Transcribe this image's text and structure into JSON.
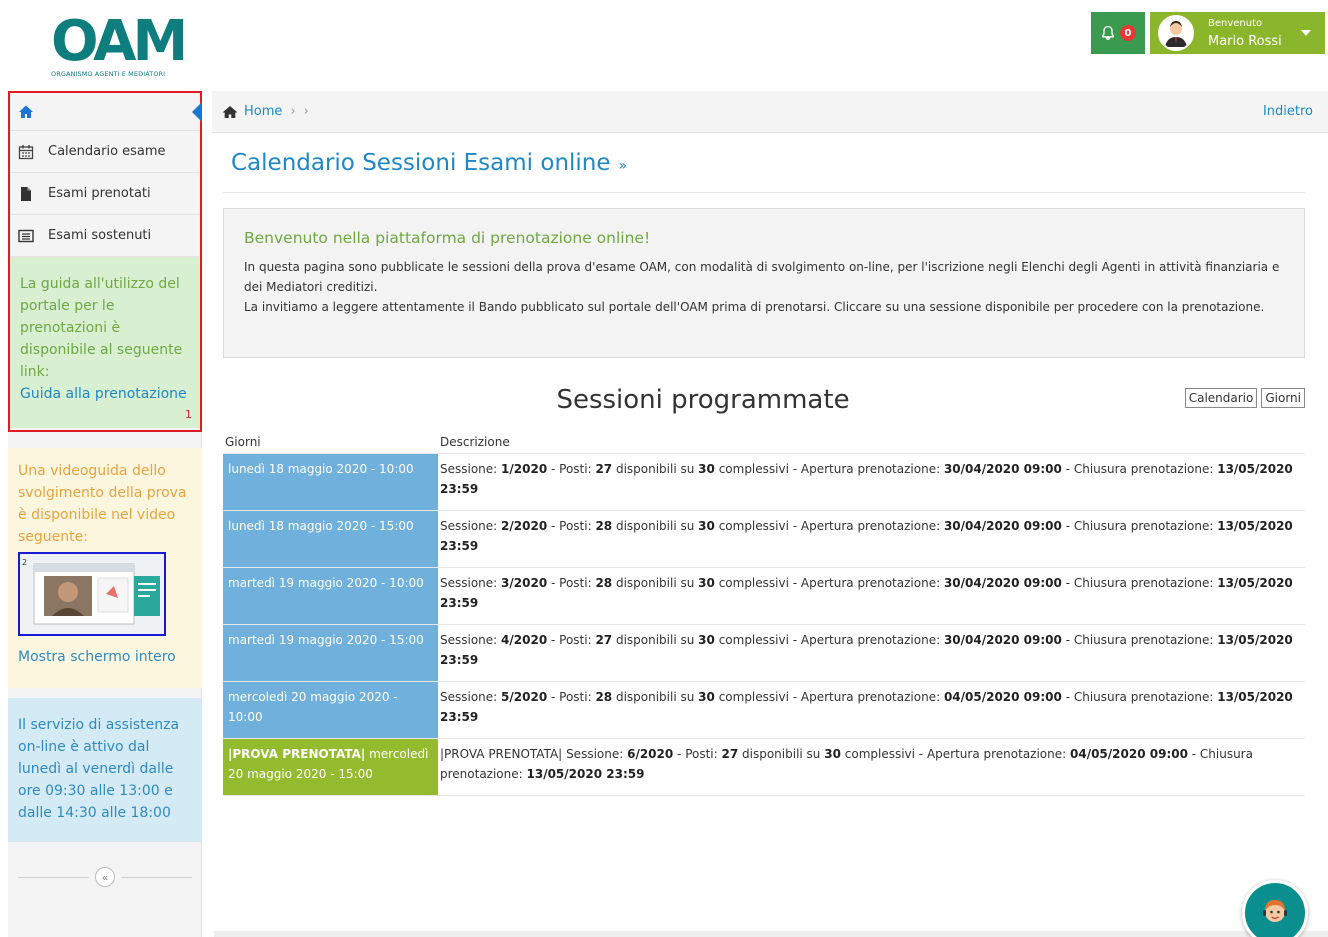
{
  "header": {
    "logo_text": "OAM",
    "logo_subtitle": "ORGANISMO AGENTI E MEDIATORI",
    "notification_count": "0",
    "user_welcome": "Benvenuto",
    "user_name": "Mario Rossi"
  },
  "sidebar": {
    "items": [
      {
        "label": "Calendario esame",
        "icon": "calendar-icon"
      },
      {
        "label": "Esami prenotati",
        "icon": "file-icon"
      },
      {
        "label": "Esami sostenuti",
        "icon": "list-icon"
      }
    ],
    "guide_text": "La guida all'utilizzo del portale per le prenotazioni è disponibile al seguente link:",
    "guide_link": "Guida alla prenotazione",
    "guide_number": "1",
    "video_text": "Una videoguida dello svolgimento della prova è disponibile nel video seguente:",
    "video_number": "2",
    "fullscreen_link": "Mostra schermo intero",
    "assist_text": "Il servizio di assistenza on-line è attivo dal lunedì al venerdì dalle ore 09:30 alle 13:00 e dalle 14:30 alle 18:00",
    "collapse_symbol": "«"
  },
  "breadcrumb": {
    "home": "Home",
    "separator": "›",
    "back": "Indietro"
  },
  "main": {
    "page_title": "Calendario Sessioni Esami online",
    "title_suffix": "»",
    "welcome_title": "Benvenuto nella piattaforma di prenotazione online!",
    "welcome_line1": "In questa pagina sono pubblicate le sessioni della prova d'esame OAM, con modalità di svolgimento on-line, per l'iscrizione negli Elenchi degli Agenti in attività finanziaria e dei Mediatori creditizi.",
    "welcome_line2": "La invitiamo a leggere attentamente il Bando pubblicato sul portale dell'OAM prima di prenotarsi. Cliccare su una sessione disponibile per procedere con la prenotazione.",
    "sessions_title": "Sessioni programmate",
    "view_calendar": "Calendario",
    "view_days": "Giorni",
    "col_days": "Giorni",
    "col_description": "Descrizione"
  },
  "sessions": [
    {
      "day": "lunedì 18 maggio 2020 - 10:00",
      "prefix": "",
      "session": "1/2020",
      "posti": "27",
      "total": "30",
      "open": "30/04/2020 09:00",
      "close": "13/05/2020 23:59",
      "booked": false
    },
    {
      "day": "lunedì 18 maggio 2020 - 15:00",
      "prefix": "",
      "session": "2/2020",
      "posti": "28",
      "total": "30",
      "open": "30/04/2020 09:00",
      "close": "13/05/2020 23:59",
      "booked": false
    },
    {
      "day": "martedì 19 maggio 2020 - 10:00",
      "prefix": "",
      "session": "3/2020",
      "posti": "28",
      "total": "30",
      "open": "30/04/2020 09:00",
      "close": "13/05/2020 23:59",
      "booked": false
    },
    {
      "day": "martedì 19 maggio 2020 - 15:00",
      "prefix": "",
      "session": "4/2020",
      "posti": "27",
      "total": "30",
      "open": "30/04/2020 09:00",
      "close": "13/05/2020 23:59",
      "booked": false
    },
    {
      "day": "mercoledì 20 maggio 2020 - 10:00",
      "prefix": "",
      "session": "5/2020",
      "posti": "28",
      "total": "30",
      "open": "04/05/2020 09:00",
      "close": "13/05/2020 23:59",
      "booked": false
    },
    {
      "day": "mercoledì 20 maggio 2020 - 15:00",
      "prefix": "|PROVA PRENOTATA|",
      "session": "6/2020",
      "posti": "27",
      "total": "30",
      "open": "04/05/2020 09:00",
      "close": "13/05/2020 23:59",
      "booked": true
    }
  ],
  "colors": {
    "accent": "#1e88c7",
    "available_day": "#6fb0dd",
    "booked_day": "#93bb2d",
    "user_button": "#8bb52b",
    "notif_button": "#3a9b50",
    "guide_bg": "#d9efd2",
    "video_bg": "#fdf6df",
    "assist_bg": "#d4eaf4"
  }
}
